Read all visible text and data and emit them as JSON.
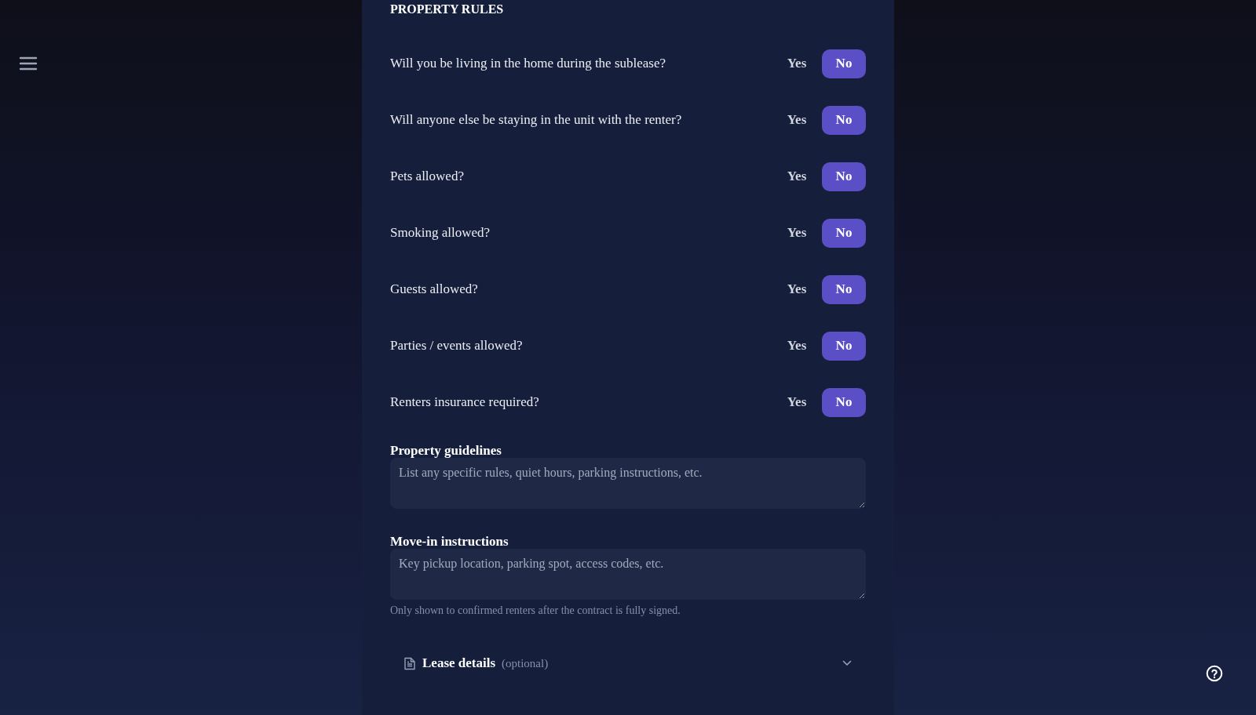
{
  "section": {
    "title": "PROPERTY RULES",
    "questions": [
      {
        "label": "Will you be living in the home during the sublease?",
        "options": [
          {
            "label": "Yes",
            "selected": false
          },
          {
            "label": "No",
            "selected": true
          }
        ]
      },
      {
        "label": "Will anyone else be staying in the unit with the renter?",
        "options": [
          {
            "label": "Yes",
            "selected": false
          },
          {
            "label": "No",
            "selected": true
          }
        ]
      },
      {
        "label": "Pets allowed?",
        "options": [
          {
            "label": "Yes",
            "selected": false
          },
          {
            "label": "No",
            "selected": true
          }
        ]
      },
      {
        "label": "Smoking allowed?",
        "options": [
          {
            "label": "Yes",
            "selected": false
          },
          {
            "label": "No",
            "selected": true
          }
        ]
      },
      {
        "label": "Guests allowed?",
        "options": [
          {
            "label": "Yes",
            "selected": false
          },
          {
            "label": "No",
            "selected": true
          }
        ]
      },
      {
        "label": "Parties / events allowed?",
        "options": [
          {
            "label": "Yes",
            "selected": false
          },
          {
            "label": "No",
            "selected": true
          }
        ]
      },
      {
        "label": "Renters insurance required?",
        "options": [
          {
            "label": "Yes",
            "selected": false
          },
          {
            "label": "No",
            "selected": true
          }
        ]
      }
    ],
    "fields": [
      {
        "label": "Property guidelines",
        "placeholder": "List any specific rules, quiet hours, parking instructions, etc."
      },
      {
        "label": "Move-in instructions",
        "placeholder": "Key pickup location, parking spot, access codes, etc.",
        "help": "Only shown to confirmed renters after the contract is fully signed."
      }
    ]
  },
  "collapsible": {
    "title": "Lease details",
    "note": "(optional)",
    "expanded": false
  }
}
